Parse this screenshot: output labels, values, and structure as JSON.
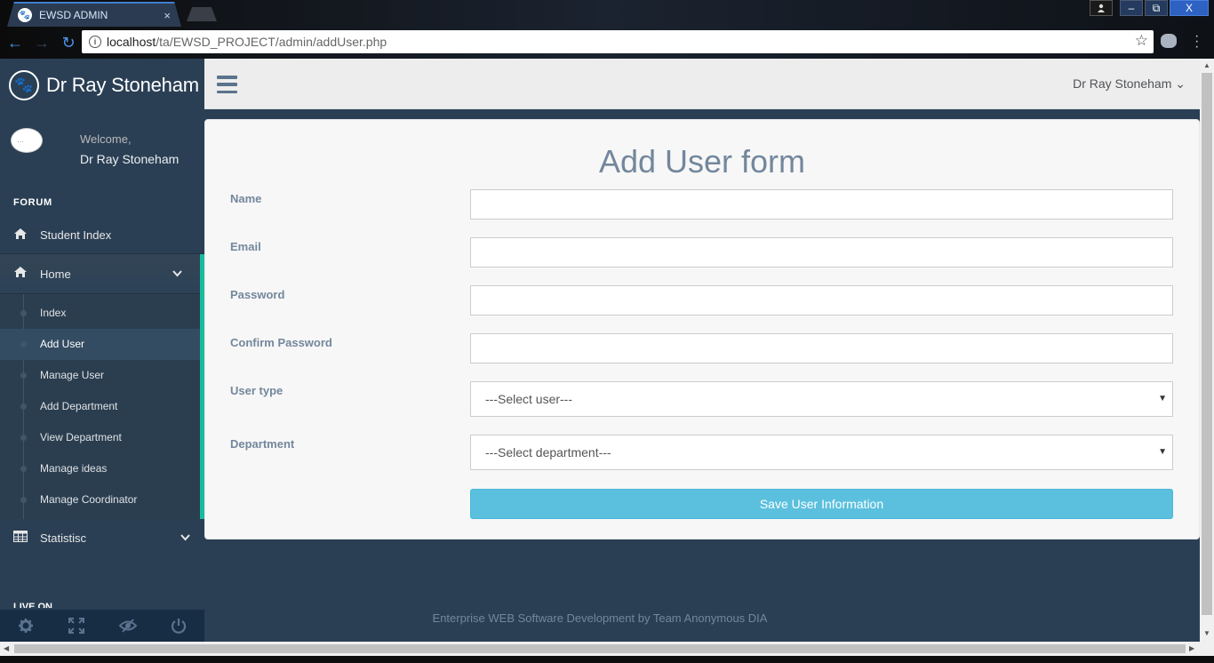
{
  "browser": {
    "tab_title": "EWSD ADMIN",
    "tab_close": "×",
    "url_host": "localhost",
    "url_path": "/ta/EWSD_PROJECT/admin/addUser.php",
    "info_icon": "i",
    "bookmark_icon": "star-icon",
    "win_user_icon": "user-icon",
    "win_minimize": "‒",
    "win_restore": "⧉",
    "win_close": "X"
  },
  "sidebar": {
    "brand_name": "Dr Ray Stoneham",
    "brand_icon": "paw-icon",
    "welcome": "Welcome,",
    "profile_name": "Dr Ray Stoneham",
    "section_title": "FORUM",
    "student_index": "Student Index",
    "home": "Home",
    "sub_items": [
      "Index",
      "Add User",
      "Manage User",
      "Add Department",
      "View Department",
      "Manage ideas",
      "Manage Coordinator"
    ],
    "statistics": "Statistisc",
    "live_on": "LIVE ON",
    "footer_icons": [
      "gear-icon",
      "fullscreen-icon",
      "eye-slash-icon",
      "power-icon"
    ]
  },
  "topnav": {
    "user_name": "Dr Ray Stoneham",
    "user_caret": "⌄"
  },
  "form": {
    "title": "Add User form",
    "name_label": "Name",
    "email_label": "Email",
    "password_label": "Password",
    "confirm_label": "Confirm Password",
    "usertype_label": "User type",
    "usertype_value": "---Select user---",
    "department_label": "Department",
    "department_value": "---Select department---",
    "submit_label": "Save User Information"
  },
  "footer": {
    "text": "Enterprise WEB Software Development by Team Anonymous DIA"
  },
  "colors": {
    "sidebar_bg": "#2a3f54",
    "accent_green": "#1abb9c",
    "button_info": "#5bc0de",
    "label_text": "#73879c"
  }
}
